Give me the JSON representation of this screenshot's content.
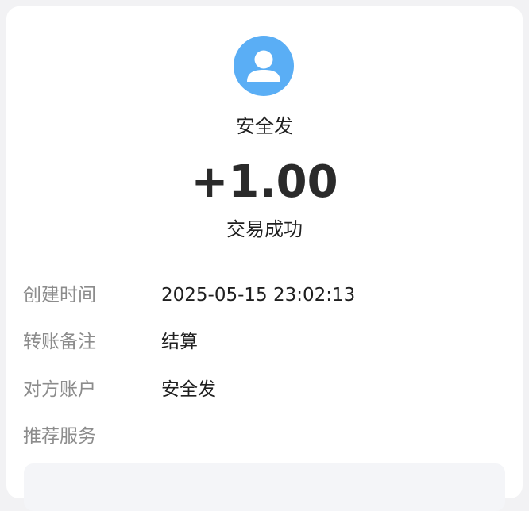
{
  "header": {
    "payee_name": "安全发",
    "amount": "+1.00",
    "status": "交易成功"
  },
  "details": [
    {
      "label": "创建时间",
      "value": "2025-05-15 23:02:13"
    },
    {
      "label": "转账备注",
      "value": "结算"
    },
    {
      "label": "对方账户",
      "value": "安全发"
    },
    {
      "label": "推荐服务",
      "value": ""
    }
  ],
  "colors": {
    "avatar_bg": "#5aaef5",
    "label_text": "#8c8c8c",
    "primary_text": "#1f1f1f"
  },
  "icons": {
    "avatar": "user-silhouette-icon"
  }
}
